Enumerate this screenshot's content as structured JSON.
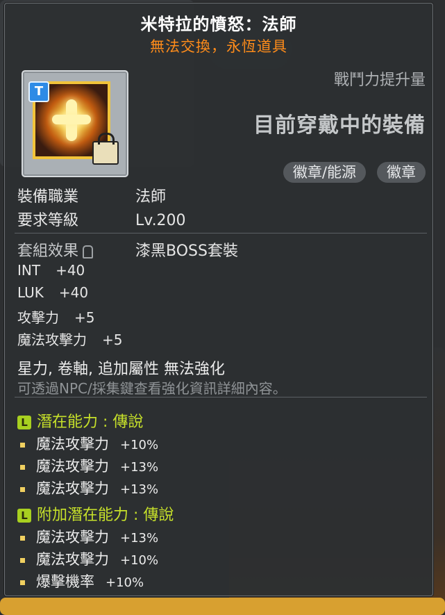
{
  "item": {
    "name": "米特拉的憤怒：法師",
    "trade_note": "無法交換，永恆道具",
    "icon": "mitra-rage-emblem-icon",
    "t_badge": "T"
  },
  "header": {
    "power_label": "戰鬥力提升量",
    "equipped_label": "目前穿戴中的裝備",
    "categories": [
      "徽章/能源",
      "徽章"
    ]
  },
  "requirements": [
    {
      "label": "裝備職業",
      "value": "法師"
    },
    {
      "label": "要求等級",
      "value": "Lv.200"
    }
  ],
  "set_effect": {
    "label": "套組效果",
    "value": "漆黑BOSS套裝"
  },
  "stats": [
    {
      "name": "INT",
      "value": "+40"
    },
    {
      "name": "LUK",
      "value": "+40"
    },
    {
      "name": "攻擊力",
      "value": "+5"
    },
    {
      "name": "魔法攻擊力",
      "value": "+5"
    }
  ],
  "notes": {
    "enhance": "星力, 卷軸, 追加屬性 無法強化",
    "hint": "可透過NPC/採集鍵查看強化資訊詳細內容。"
  },
  "potential": {
    "badge": "L",
    "title": "潛在能力 : 傳說",
    "lines": [
      {
        "name": "魔法攻擊力",
        "value": "+10%"
      },
      {
        "name": "魔法攻擊力",
        "value": "+13%"
      },
      {
        "name": "魔法攻擊力",
        "value": "+13%"
      }
    ]
  },
  "bonus_potential": {
    "badge": "L",
    "title": "附加潛在能力 : 傳說",
    "lines": [
      {
        "name": "魔法攻擊力",
        "value": "+13%"
      },
      {
        "name": "魔法攻擊力",
        "value": "+10%"
      },
      {
        "name": "爆擊機率",
        "value": "+10%"
      }
    ]
  },
  "colors": {
    "title": "#ffffff",
    "trade_note": "#ff8c1a",
    "potential": "#c6e02a"
  }
}
